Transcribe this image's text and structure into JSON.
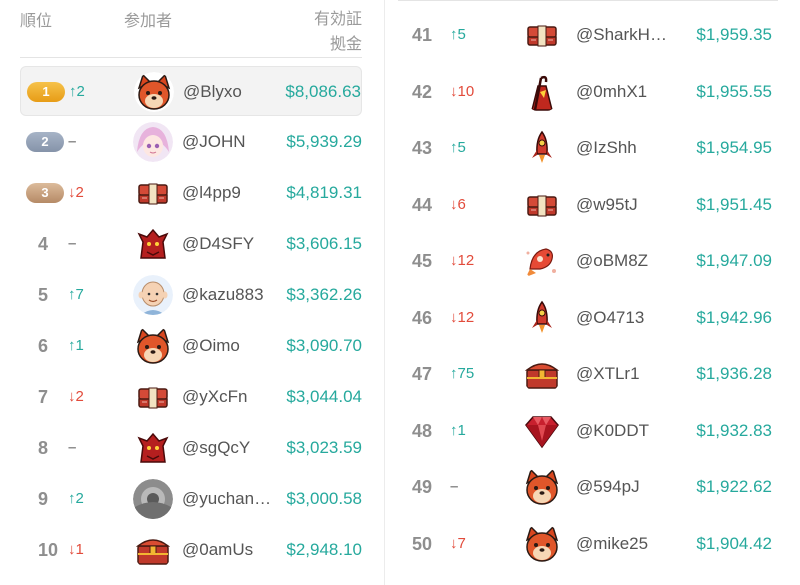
{
  "header": {
    "rank_label": "順位",
    "participant_label": "参加者",
    "prize_label_line1": "有効証",
    "prize_label_line2": "拠金"
  },
  "colors": {
    "up": "#26a99d",
    "down": "#e24b3b",
    "prize": "#26a99d",
    "gold": "#eaa31e",
    "silver": "#8e9cb0",
    "bronze": "#c49c78"
  },
  "left_rows": [
    {
      "rank": "1",
      "change": "↑2",
      "dir": "up",
      "avatar": "shiba-dog-icon",
      "name": "@Blyxo",
      "prize": "$8,086.63"
    },
    {
      "rank": "2",
      "change": "–",
      "dir": "flat",
      "avatar": "anime-girl-icon",
      "name": "@JOHN",
      "prize": "$5,939.29"
    },
    {
      "rank": "3",
      "change": "↓2",
      "dir": "down",
      "avatar": "money-stack-icon",
      "name": "@l4pp9",
      "prize": "$4,819.31"
    },
    {
      "rank": "4",
      "change": "–",
      "dir": "flat",
      "avatar": "red-dragon-icon",
      "name": "@D4SFY",
      "prize": "$3,606.15"
    },
    {
      "rank": "5",
      "change": "↑7",
      "dir": "up",
      "avatar": "bald-man-icon",
      "name": "@kazu883",
      "prize": "$3,362.26"
    },
    {
      "rank": "6",
      "change": "↑1",
      "dir": "up",
      "avatar": "shiba-dog-icon",
      "name": "@Oimo",
      "prize": "$3,090.70"
    },
    {
      "rank": "7",
      "change": "↓2",
      "dir": "down",
      "avatar": "money-stack-icon",
      "name": "@yXcFn",
      "prize": "$3,044.04"
    },
    {
      "rank": "8",
      "change": "–",
      "dir": "flat",
      "avatar": "red-dragon-icon",
      "name": "@sgQcY",
      "prize": "$3,023.59"
    },
    {
      "rank": "9",
      "change": "↑2",
      "dir": "up",
      "avatar": "photo-avatar-icon",
      "name": "@yuchan…",
      "prize": "$3,000.58"
    },
    {
      "rank": "10",
      "change": "↓1",
      "dir": "down",
      "avatar": "treasure-chest-icon",
      "name": "@0amUs",
      "prize": "$2,948.10"
    }
  ],
  "right_rows": [
    {
      "rank": "41",
      "change": "↑5",
      "dir": "up",
      "avatar": "money-stack-icon",
      "name": "@SharkH…",
      "prize": "$1,959.35"
    },
    {
      "rank": "42",
      "change": "↓10",
      "dir": "down",
      "avatar": "staff-robe-icon",
      "name": "@0mhX1",
      "prize": "$1,955.55"
    },
    {
      "rank": "43",
      "change": "↑5",
      "dir": "up",
      "avatar": "rocket-icon",
      "name": "@IzShh",
      "prize": "$1,954.95"
    },
    {
      "rank": "44",
      "change": "↓6",
      "dir": "down",
      "avatar": "money-stack-icon",
      "name": "@w95tJ",
      "prize": "$1,951.45"
    },
    {
      "rank": "45",
      "change": "↓12",
      "dir": "down",
      "avatar": "koi-fish-icon",
      "name": "@oBM8Z",
      "prize": "$1,947.09"
    },
    {
      "rank": "46",
      "change": "↓12",
      "dir": "down",
      "avatar": "rocket-icon",
      "name": "@O4713",
      "prize": "$1,942.96"
    },
    {
      "rank": "47",
      "change": "↑75",
      "dir": "up",
      "avatar": "treasure-chest-icon",
      "name": "@XTLr1",
      "prize": "$1,936.28"
    },
    {
      "rank": "48",
      "change": "↑1",
      "dir": "up",
      "avatar": "ruby-gem-icon",
      "name": "@K0DDT",
      "prize": "$1,932.83"
    },
    {
      "rank": "49",
      "change": "–",
      "dir": "flat",
      "avatar": "shiba-dog-icon",
      "name": "@594pJ",
      "prize": "$1,922.62"
    },
    {
      "rank": "50",
      "change": "↓7",
      "dir": "down",
      "avatar": "shiba-dog-icon",
      "name": "@mike25",
      "prize": "$1,904.42"
    }
  ]
}
